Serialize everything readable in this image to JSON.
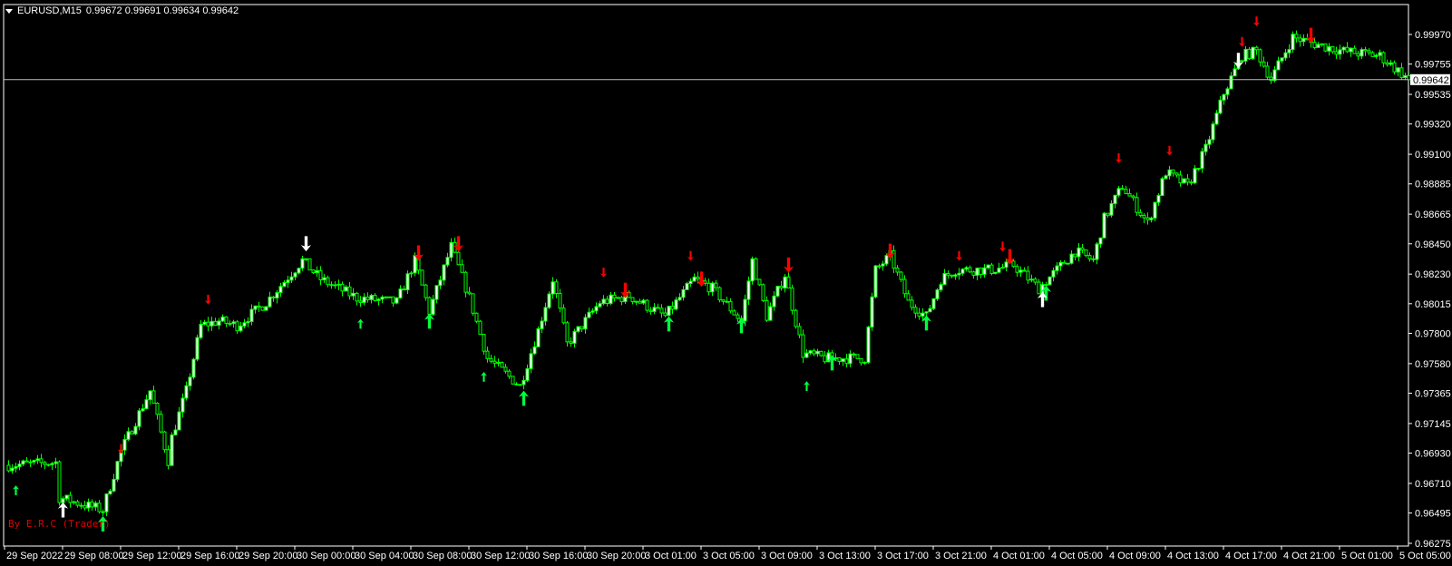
{
  "header": {
    "symbol_timeframe": "EURUSD,M15",
    "ohlc": "0.99672 0.99691 0.99634 0.99642"
  },
  "signature": "By E.R.C (Trader)",
  "colors": {
    "background": "#000000",
    "candle": "#00ff00",
    "grid": "#ffffff",
    "sell_arrow": "#ff0000",
    "buy_arrow": "#00ff40",
    "signal_white": "#ffffff",
    "price_line": "#c0c0c0"
  },
  "chart_data": {
    "type": "candlestick",
    "symbol": "EURUSD",
    "timeframe": "M15",
    "current_price": "0.99642",
    "ylim": [
      0.96275,
      0.9997
    ],
    "y_ticks": [
      "0.99970",
      "0.99755",
      "0.99535",
      "0.99320",
      "0.99100",
      "0.98885",
      "0.98665",
      "0.98450",
      "0.98230",
      "0.98015",
      "0.97800",
      "0.97580",
      "0.97365",
      "0.97145",
      "0.96930",
      "0.96710",
      "0.96495",
      "0.96275"
    ],
    "x_ticks": [
      "29 Sep 2022",
      "29 Sep 08:00",
      "29 Sep 12:00",
      "29 Sep 16:00",
      "29 Sep 20:00",
      "30 Sep 00:00",
      "30 Sep 04:00",
      "30 Sep 08:00",
      "30 Sep 12:00",
      "30 Sep 16:00",
      "30 Sep 20:00",
      "3 Oct 01:00",
      "3 Oct 05:00",
      "3 Oct 09:00",
      "3 Oct 13:00",
      "3 Oct 17:00",
      "3 Oct 21:00",
      "4 Oct 01:00",
      "4 Oct 05:00",
      "4 Oct 09:00",
      "4 Oct 13:00",
      "4 Oct 17:00",
      "4 Oct 21:00",
      "5 Oct 01:00",
      "5 Oct 05:00"
    ],
    "bars_per_tick": 16,
    "bar_count": 387,
    "price_path": [
      [
        0,
        0.96842
      ],
      [
        13,
        0.96862
      ],
      [
        14,
        0.96606
      ],
      [
        23,
        0.96538
      ],
      [
        26,
        0.96518
      ],
      [
        31,
        0.96944
      ],
      [
        39,
        0.97383
      ],
      [
        44,
        0.96876
      ],
      [
        45,
        0.97045
      ],
      [
        49,
        0.97383
      ],
      [
        53,
        0.97856
      ],
      [
        58,
        0.97889
      ],
      [
        63,
        0.97856
      ],
      [
        71,
        0.98025
      ],
      [
        81,
        0.98329
      ],
      [
        86,
        0.98193
      ],
      [
        96,
        0.98058
      ],
      [
        107,
        0.98025
      ],
      [
        112,
        0.98329
      ],
      [
        116,
        0.97957
      ],
      [
        122,
        0.9843
      ],
      [
        127,
        0.98058
      ],
      [
        132,
        0.97619
      ],
      [
        141,
        0.97417
      ],
      [
        146,
        0.97822
      ],
      [
        150,
        0.98193
      ],
      [
        154,
        0.97721
      ],
      [
        163,
        0.98025
      ],
      [
        171,
        0.98072
      ],
      [
        181,
        0.97923
      ],
      [
        189,
        0.98193
      ],
      [
        194,
        0.98126
      ],
      [
        202,
        0.97889
      ],
      [
        205,
        0.98329
      ],
      [
        209,
        0.97923
      ],
      [
        214,
        0.98227
      ],
      [
        219,
        0.97653
      ],
      [
        225,
        0.97619
      ],
      [
        236,
        0.97619
      ],
      [
        239,
        0.98261
      ],
      [
        243,
        0.98362
      ],
      [
        248,
        0.98025
      ],
      [
        253,
        0.97923
      ],
      [
        257,
        0.98193
      ],
      [
        261,
        0.98261
      ],
      [
        271,
        0.98261
      ],
      [
        277,
        0.98295
      ],
      [
        284,
        0.98126
      ],
      [
        289,
        0.98261
      ],
      [
        294,
        0.98396
      ],
      [
        299,
        0.98329
      ],
      [
        302,
        0.98633
      ],
      [
        307,
        0.98869
      ],
      [
        314,
        0.98599
      ],
      [
        319,
        0.9897
      ],
      [
        325,
        0.98869
      ],
      [
        330,
        0.99139
      ],
      [
        335,
        0.99544
      ],
      [
        340,
        0.99815
      ],
      [
        344,
        0.99848
      ],
      [
        348,
        0.99646
      ],
      [
        354,
        0.9995
      ],
      [
        358,
        0.99916
      ],
      [
        368,
        0.99848
      ],
      [
        378,
        0.99815
      ],
      [
        386,
        0.99642
      ]
    ],
    "signals": [
      {
        "type": "sell",
        "size": "small",
        "bar": 31,
        "price": 0.9696
      },
      {
        "type": "sell",
        "size": "small",
        "bar": 55,
        "price": 0.98045
      },
      {
        "type": "sell",
        "size": "small",
        "bar": 164,
        "price": 0.98241
      },
      {
        "type": "sell",
        "size": "small",
        "bar": 188,
        "price": 0.98362
      },
      {
        "type": "sell",
        "size": "small",
        "bar": 262,
        "price": 0.98362
      },
      {
        "type": "sell",
        "size": "small",
        "bar": 274,
        "price": 0.9843
      },
      {
        "type": "sell",
        "size": "small",
        "bar": 306,
        "price": 0.99072
      },
      {
        "type": "sell",
        "size": "small",
        "bar": 320,
        "price": 0.99126
      },
      {
        "type": "sell",
        "size": "small",
        "bar": 344,
        "price": 1.00065
      },
      {
        "type": "sell",
        "size": "small",
        "bar": 340,
        "price": 0.99916
      },
      {
        "type": "sell",
        "size": "big",
        "bar": 113,
        "price": 0.98383
      },
      {
        "type": "sell",
        "size": "big",
        "bar": 124,
        "price": 0.9845
      },
      {
        "type": "sell",
        "size": "big",
        "bar": 170,
        "price": 0.98112
      },
      {
        "type": "sell",
        "size": "big",
        "bar": 191,
        "price": 0.98193
      },
      {
        "type": "sell",
        "size": "big",
        "bar": 215,
        "price": 0.98295
      },
      {
        "type": "sell",
        "size": "big",
        "bar": 243,
        "price": 0.98396
      },
      {
        "type": "sell",
        "size": "big",
        "bar": 276,
        "price": 0.98356
      },
      {
        "type": "sell",
        "size": "big",
        "bar": 359,
        "price": 0.99963
      },
      {
        "type": "buy",
        "size": "small",
        "bar": 2,
        "price": 0.9666
      },
      {
        "type": "buy",
        "size": "small",
        "bar": 97,
        "price": 0.97869
      },
      {
        "type": "buy",
        "size": "small",
        "bar": 131,
        "price": 0.97484
      },
      {
        "type": "buy",
        "size": "small",
        "bar": 220,
        "price": 0.97417
      },
      {
        "type": "buy",
        "size": "big",
        "bar": 26,
        "price": 0.96417
      },
      {
        "type": "buy",
        "size": "big",
        "bar": 116,
        "price": 0.97889
      },
      {
        "type": "buy",
        "size": "big",
        "bar": 142,
        "price": 0.97329
      },
      {
        "type": "buy",
        "size": "big",
        "bar": 182,
        "price": 0.97869
      },
      {
        "type": "buy",
        "size": "big",
        "bar": 202,
        "price": 0.97856
      },
      {
        "type": "buy",
        "size": "big",
        "bar": 227,
        "price": 0.97586
      },
      {
        "type": "buy",
        "size": "big",
        "bar": 253,
        "price": 0.97876
      },
      {
        "type": "buy",
        "size": "big",
        "bar": 286,
        "price": 0.98092
      },
      {
        "type": "buy-white",
        "size": "big",
        "bar": 15,
        "price": 0.96518
      },
      {
        "type": "buy-white",
        "size": "big",
        "bar": 285,
        "price": 0.98045
      },
      {
        "type": "sell-white",
        "size": "big",
        "bar": 82,
        "price": 0.9845
      },
      {
        "type": "sell-white",
        "size": "big",
        "bar": 339,
        "price": 0.99781
      }
    ]
  }
}
